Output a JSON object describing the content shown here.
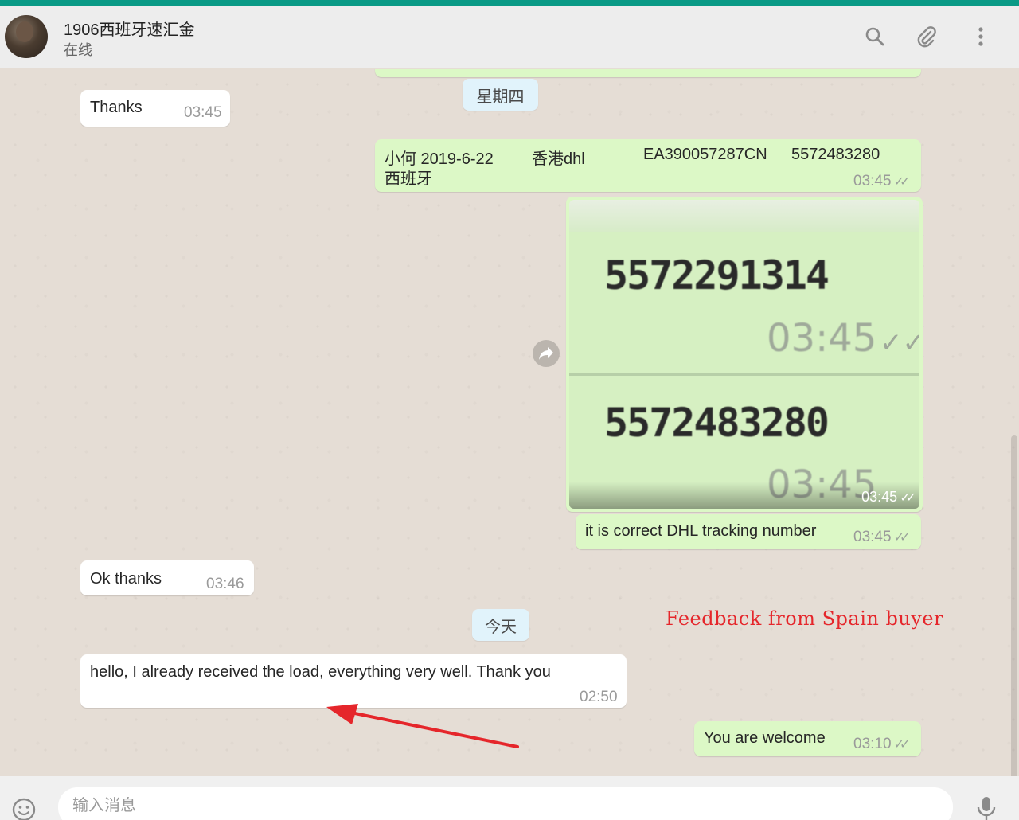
{
  "header": {
    "contact_name": "1906西班牙速汇金",
    "status": "在线"
  },
  "chat": {
    "day_thursday": "星期四",
    "day_today": "今天",
    "messages": [
      {
        "text": "Thanks",
        "time": "03:45"
      },
      {
        "line1": "小何 2019-6-22",
        "carrier": "香港dhl",
        "tracking": "EA390057287CN",
        "number": "5572483280",
        "line2": "西班牙",
        "time": "03:45"
      },
      {
        "image_number_1": "5572291314",
        "image_time_1": "03:45",
        "image_number_2": "5572483280",
        "image_time_2": "03:45",
        "time": "03:45"
      },
      {
        "text": "it is correct DHL tracking number",
        "time": "03:45"
      },
      {
        "text": "Ok thanks",
        "time": "03:46"
      },
      {
        "text": "hello, I already received the load, everything very well. Thank you",
        "time": "02:50"
      },
      {
        "text": "You are welcome",
        "time": "03:10"
      }
    ],
    "annotation": "Feedback from Spain buyer"
  },
  "footer": {
    "placeholder": "输入消息"
  },
  "colors": {
    "accent_bar": "#0a9a86",
    "incoming": "#ffffff",
    "outgoing": "#dcf8c6",
    "annotation": "#e5262b",
    "arrow": "#e5262b"
  },
  "icons": [
    "search-icon",
    "attach-icon",
    "menu-icon",
    "forward-icon",
    "emoji-icon",
    "mic-icon",
    "read-ticks-icon"
  ]
}
